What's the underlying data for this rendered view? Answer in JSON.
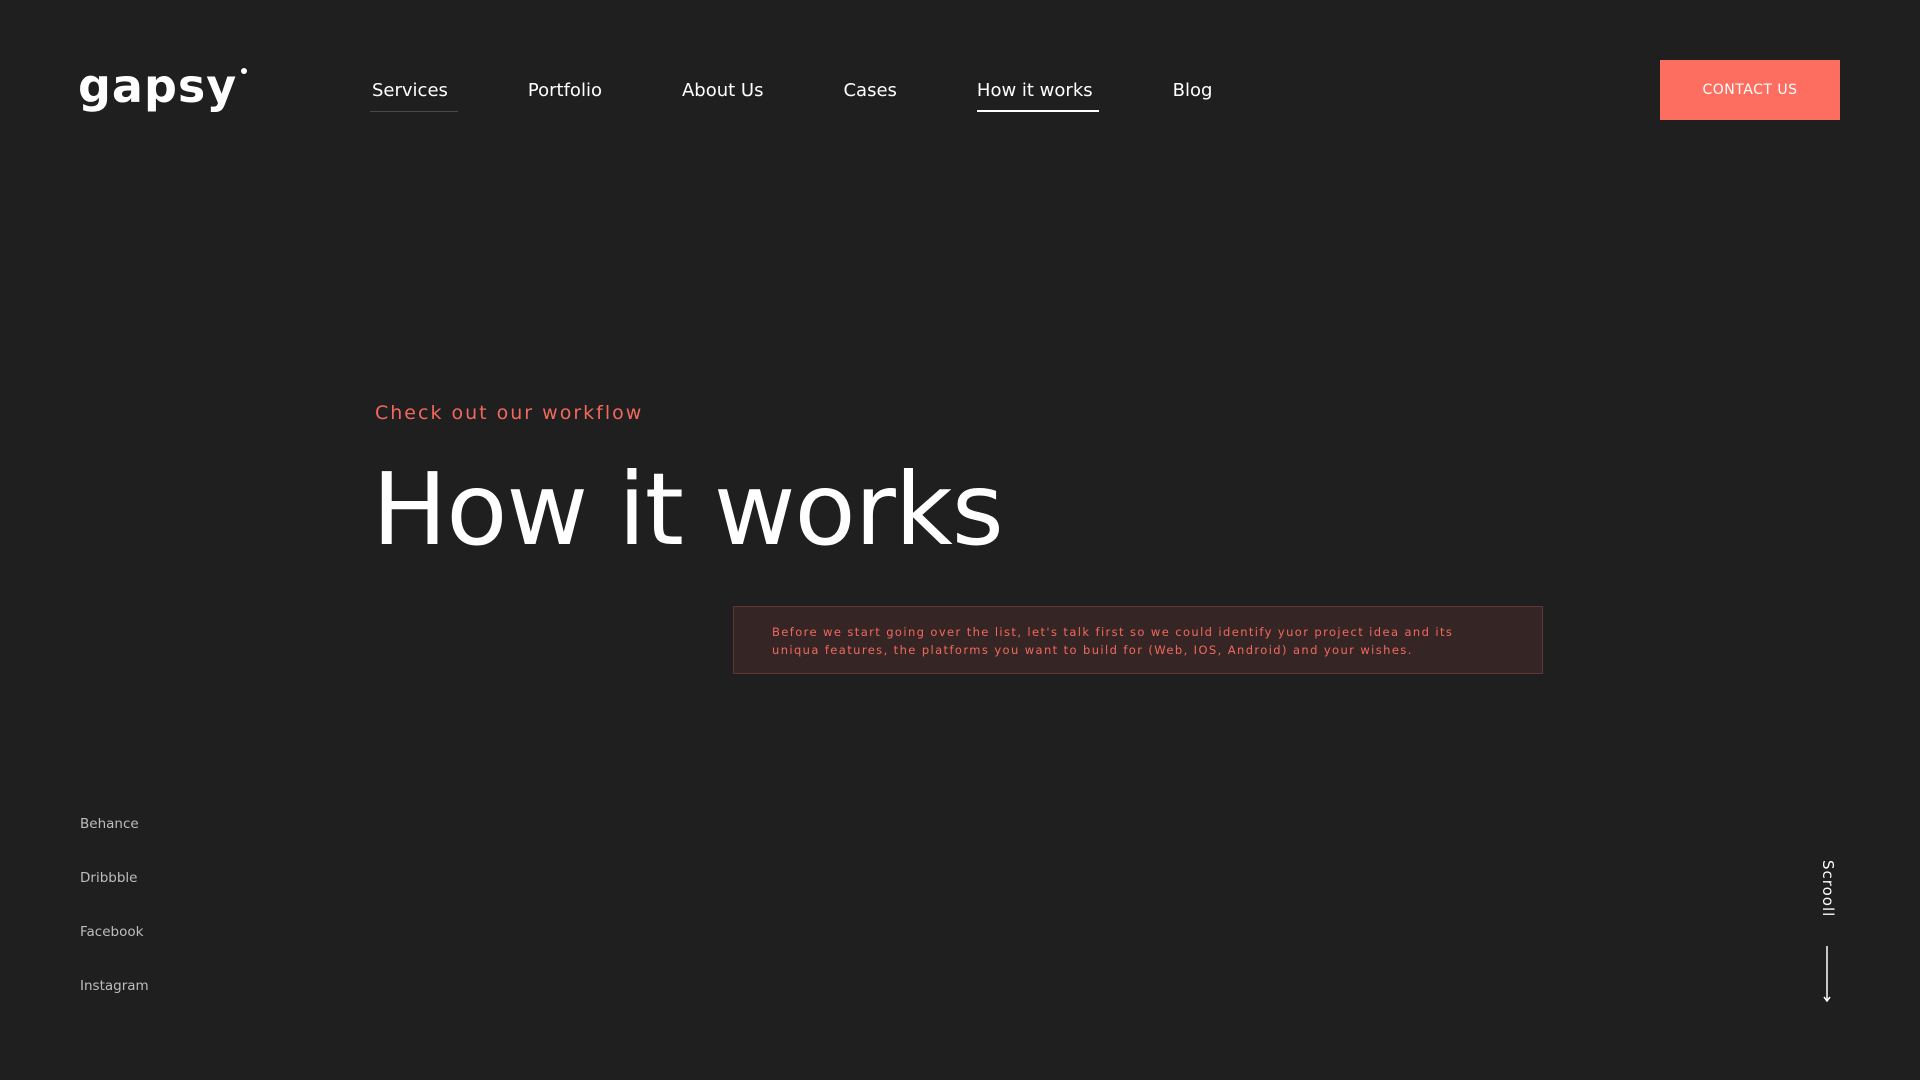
{
  "brand": {
    "logo_text": "gapsy"
  },
  "nav": {
    "items": [
      {
        "label": "Services"
      },
      {
        "label": "Portfolio"
      },
      {
        "label": "About Us"
      },
      {
        "label": "Cases"
      },
      {
        "label": "How it works"
      },
      {
        "label": "Blog"
      }
    ],
    "active": "How it works",
    "contact_label": "CONTACT US"
  },
  "hero": {
    "eyebrow": "Check out our workflow",
    "title": "How it works",
    "notice_line1": "Before we start going over the list, let's talk first so we could identify yuor project idea and its",
    "notice_line2": "uniqua features, the platforms you want to build for (Web, IOS, Android) and your wishes."
  },
  "social": {
    "links": [
      {
        "label": "Behance"
      },
      {
        "label": "Dribbble"
      },
      {
        "label": "Facebook"
      },
      {
        "label": "Instagram"
      }
    ]
  },
  "scroll": {
    "label": "Scrooll"
  },
  "colors": {
    "background": "#1f1f1f",
    "accent": "#fd6e60",
    "accent_text": "#f2685d",
    "notice_bg": "#352625",
    "text_primary": "#ffffff",
    "text_muted": "#bdbdbd"
  }
}
